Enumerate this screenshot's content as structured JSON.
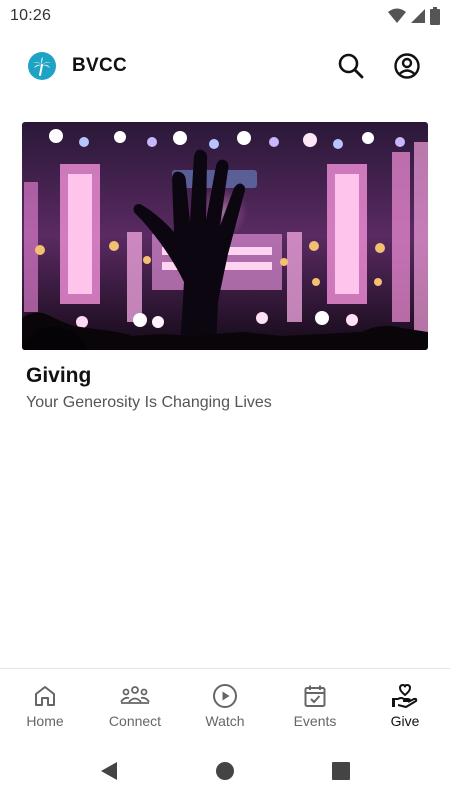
{
  "status_bar": {
    "time": "10:26"
  },
  "app_bar": {
    "brand_name": "BVCC"
  },
  "card": {
    "title": "Giving",
    "subtitle": "Your Generosity Is Changing Lives"
  },
  "bottom_nav": {
    "items": [
      {
        "label": "Home",
        "icon": "home-icon",
        "active": false
      },
      {
        "label": "Connect",
        "icon": "people-icon",
        "active": false
      },
      {
        "label": "Watch",
        "icon": "play-circle-icon",
        "active": false
      },
      {
        "label": "Events",
        "icon": "calendar-check-icon",
        "active": false
      },
      {
        "label": "Give",
        "icon": "hand-heart-icon",
        "active": true
      }
    ]
  },
  "colors": {
    "logo": "#1ea3c5",
    "active_nav": "#111111",
    "inactive_nav": "#666666"
  }
}
